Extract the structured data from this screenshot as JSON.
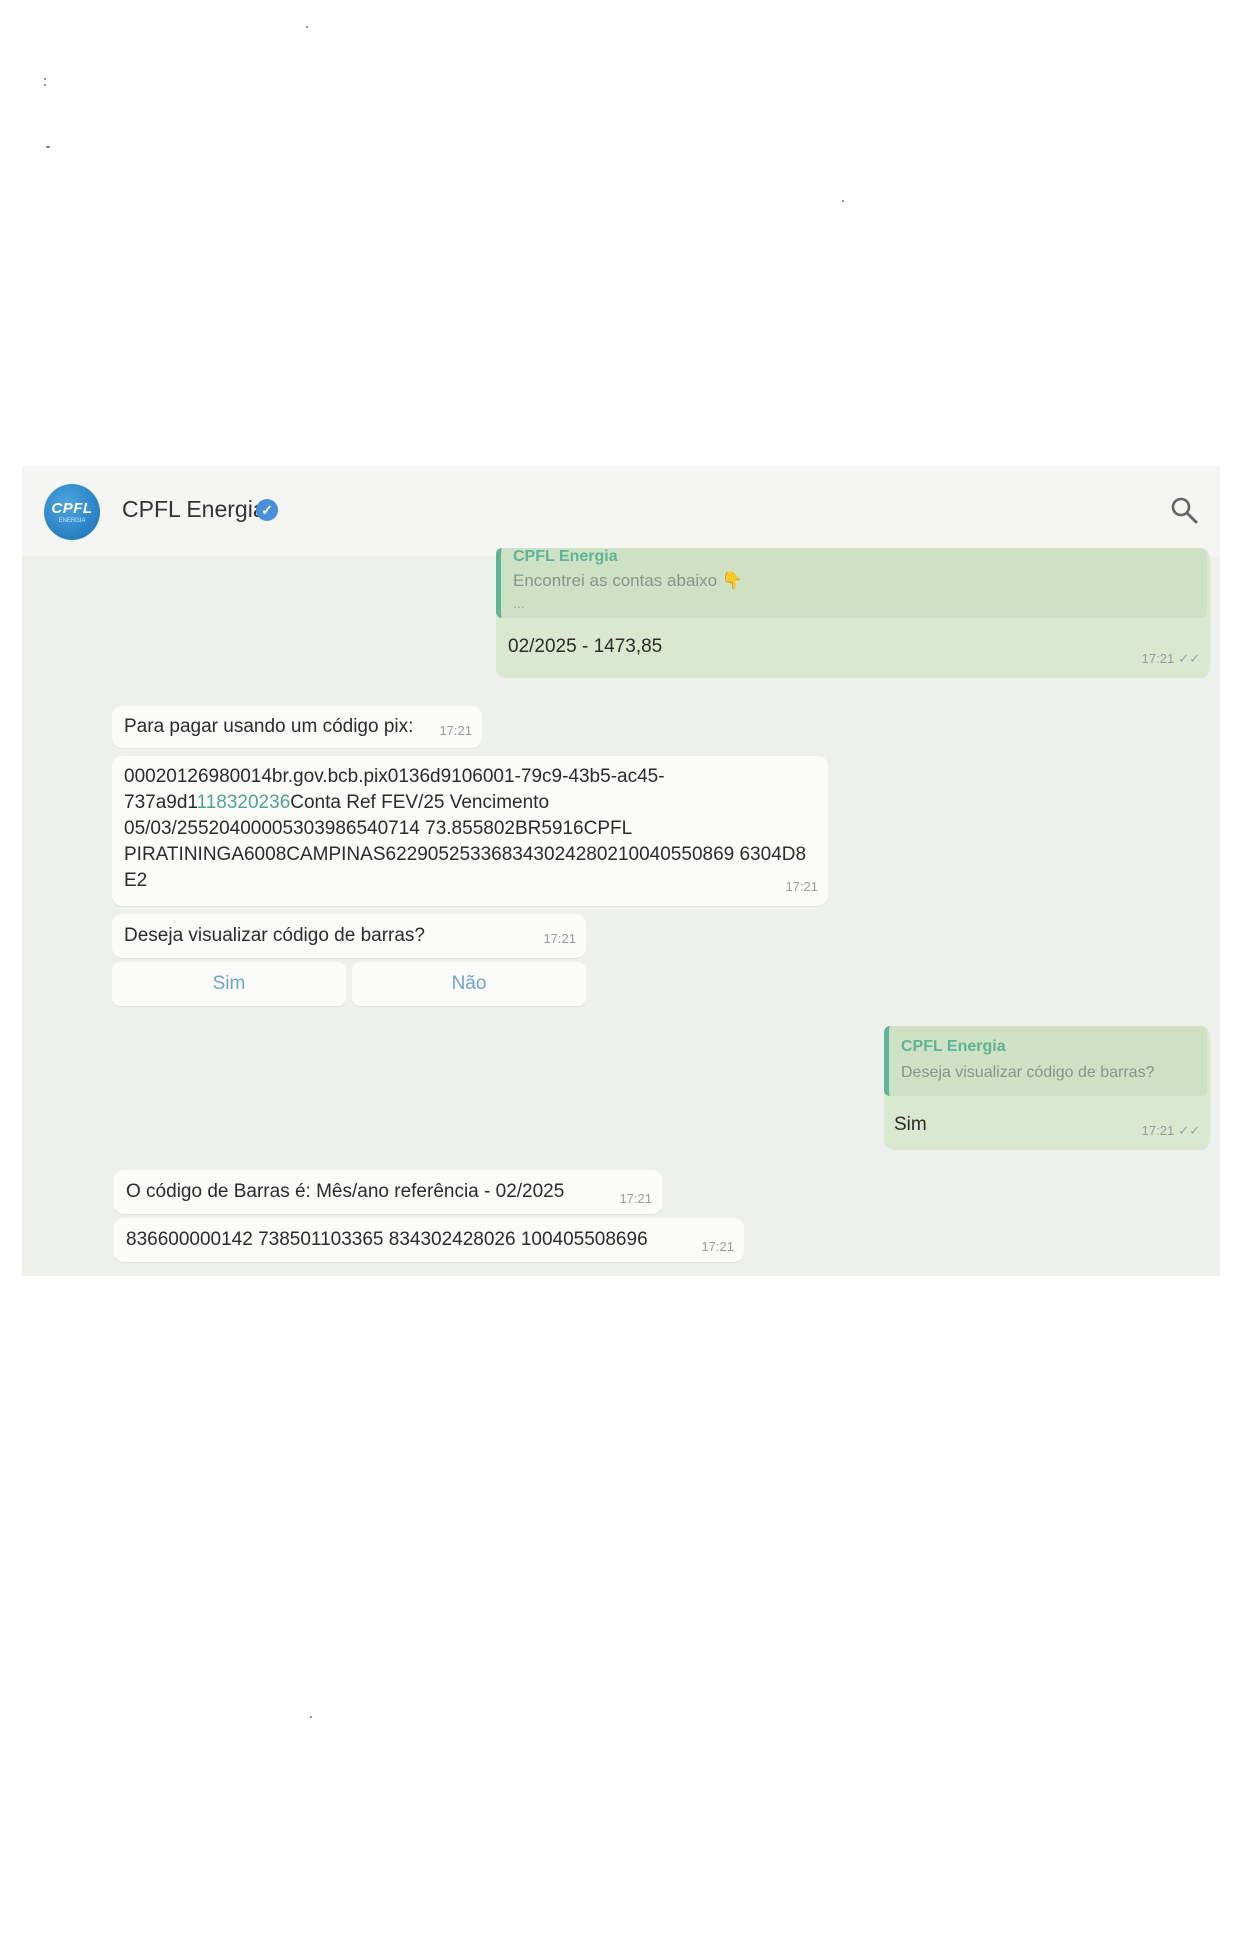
{
  "header": {
    "avatar_text": "CPFL",
    "avatar_sub": "ENERGIA",
    "title": "CPFL Energia",
    "verified_icon": "✓",
    "search_icon": "search-icon"
  },
  "messages": {
    "out1": {
      "quote_author": "CPFL Energia",
      "quote_text": "Encontrei as contas abaixo 👇",
      "quote_more": "...",
      "text": "02/2025 - 1473,85",
      "time": "17:21"
    },
    "in1": {
      "text": "Para pagar usando um código pix:",
      "time": "17:21"
    },
    "in2": {
      "line1": "00020126980014br.gov.bcb.pix0136d9106001-79c9-43b5-ac45-",
      "line2_a": "737a9d1",
      "line2_link": "118320236",
      "line2_b": "Conta Ref FEV/25 Vencimento",
      "line3": "05/03/25520400005303986540714 73.855802BR5916CPFL",
      "line4": "PIRATININGA6008CAMPINAS622905253368343024280210040550869 6304D8",
      "line5": "E2",
      "time": "17:21"
    },
    "in3": {
      "text": "Deseja visualizar código de barras?",
      "time": "17:21"
    },
    "buttons": {
      "yes": "Sim",
      "no": "Não"
    },
    "out2": {
      "quote_author": "CPFL Energia",
      "quote_text": "Deseja visualizar código de barras?",
      "text": "Sim",
      "time": "17:21"
    },
    "in4": {
      "text": "O código de Barras é: Mês/ano referência - 02/2025",
      "time": "17:21"
    },
    "in5": {
      "text": "836600000142 738501103365 834302428026 100405508696",
      "time": "17:21"
    }
  },
  "colors": {
    "chat_bg": "#eef0eb",
    "outgoing": "#d9e9cf",
    "incoming": "#fbfbfa",
    "accent": "#5fb396",
    "button_text": "#6aa6c8"
  }
}
